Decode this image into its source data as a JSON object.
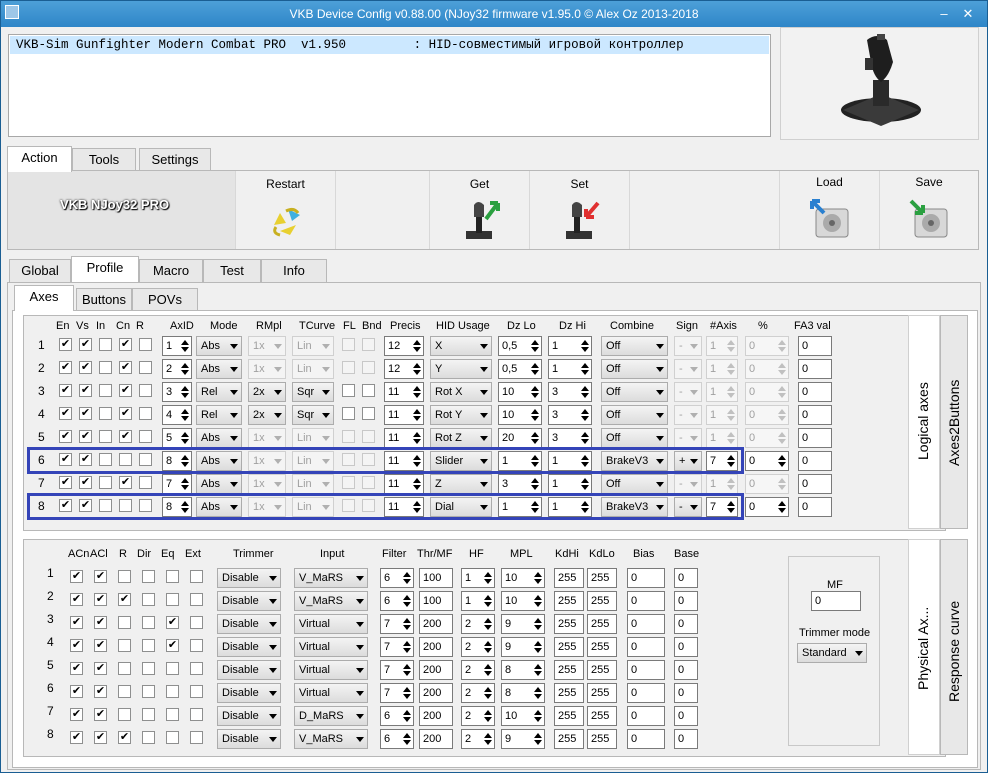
{
  "window": {
    "title": "VKB Device Config v0.88.00 (NJoy32 firmware v1.95.0 © Alex Oz 2013-2018"
  },
  "device_list": {
    "row": "VKB-Sim Gunfighter Modern Combat PRO  v1.950         : HID-совместимый игровой контроллер"
  },
  "main_tabs": [
    "Action",
    "Tools",
    "Settings"
  ],
  "toolbar": {
    "device_name": "VKB NJoy32 PRO",
    "restart": "Restart",
    "get": "Get",
    "set": "Set",
    "load": "Load",
    "save": "Save"
  },
  "section_tabs": [
    "Global",
    "Profile",
    "Macro",
    "Test",
    "Info"
  ],
  "sub_tabs": [
    "Axes",
    "Buttons",
    "POVs"
  ],
  "logical": {
    "headers": {
      "en": "En",
      "vs": "Vs",
      "in": "In",
      "cn": "Cn",
      "r": "R",
      "axid": "AxID",
      "mode": "Mode",
      "rmpl": "RMpl",
      "tcurve": "TCurve",
      "fl": "FL",
      "bnd": "Bnd",
      "precis": "Precis",
      "hid": "HID Usage",
      "dzlo": "Dz Lo",
      "dzhi": "Dz Hi",
      "combine": "Combine",
      "sign": "Sign",
      "naxis": "#Axis",
      "pct": "%",
      "fa3": "FA3 val"
    },
    "rows": [
      {
        "n": "1",
        "en": true,
        "vs": true,
        "in": false,
        "cn": true,
        "r": false,
        "axid": "1",
        "mode": "Abs",
        "rmpl": "1x",
        "rmpl_on": false,
        "tcurve": "Lin",
        "tc_on": false,
        "fl_on": false,
        "precis": "12",
        "hid": "X",
        "dzlo": "0,5",
        "dzhi": "1",
        "combine": "Off",
        "sign": "-",
        "sign_on": false,
        "naxis": "1",
        "naxis_on": false,
        "pct": "0",
        "pct_on": false,
        "fa3": "0"
      },
      {
        "n": "2",
        "en": true,
        "vs": true,
        "in": false,
        "cn": true,
        "r": false,
        "axid": "2",
        "mode": "Abs",
        "rmpl": "1x",
        "rmpl_on": false,
        "tcurve": "Lin",
        "tc_on": false,
        "fl_on": false,
        "precis": "12",
        "hid": "Y",
        "dzlo": "0,5",
        "dzhi": "1",
        "combine": "Off",
        "sign": "-",
        "sign_on": false,
        "naxis": "1",
        "naxis_on": false,
        "pct": "0",
        "pct_on": false,
        "fa3": "0"
      },
      {
        "n": "3",
        "en": true,
        "vs": true,
        "in": false,
        "cn": true,
        "r": false,
        "axid": "3",
        "mode": "Rel",
        "rmpl": "2x",
        "rmpl_on": true,
        "tcurve": "Sqr",
        "tc_on": true,
        "fl_on": true,
        "precis": "11",
        "hid": "Rot X",
        "dzlo": "10",
        "dzhi": "3",
        "combine": "Off",
        "sign": "-",
        "sign_on": false,
        "naxis": "1",
        "naxis_on": false,
        "pct": "0",
        "pct_on": false,
        "fa3": "0"
      },
      {
        "n": "4",
        "en": true,
        "vs": true,
        "in": false,
        "cn": true,
        "r": false,
        "axid": "4",
        "mode": "Rel",
        "rmpl": "2x",
        "rmpl_on": true,
        "tcurve": "Sqr",
        "tc_on": true,
        "fl_on": true,
        "precis": "11",
        "hid": "Rot Y",
        "dzlo": "10",
        "dzhi": "3",
        "combine": "Off",
        "sign": "-",
        "sign_on": false,
        "naxis": "1",
        "naxis_on": false,
        "pct": "0",
        "pct_on": false,
        "fa3": "0"
      },
      {
        "n": "5",
        "en": true,
        "vs": true,
        "in": false,
        "cn": true,
        "r": false,
        "axid": "5",
        "mode": "Abs",
        "rmpl": "1x",
        "rmpl_on": false,
        "tcurve": "Lin",
        "tc_on": false,
        "fl_on": false,
        "precis": "11",
        "hid": "Rot Z",
        "dzlo": "20",
        "dzhi": "3",
        "combine": "Off",
        "sign": "-",
        "sign_on": false,
        "naxis": "1",
        "naxis_on": false,
        "pct": "0",
        "pct_on": false,
        "fa3": "0"
      },
      {
        "n": "6",
        "en": true,
        "vs": true,
        "in": false,
        "cn": false,
        "r": false,
        "axid": "8",
        "mode": "Abs",
        "rmpl": "1x",
        "rmpl_on": false,
        "tcurve": "Lin",
        "tc_on": false,
        "fl_on": false,
        "precis": "11",
        "hid": "Slider",
        "dzlo": "1",
        "dzhi": "1",
        "combine": "BrakeV3",
        "sign": "+",
        "sign_on": true,
        "naxis": "7",
        "naxis_on": true,
        "pct": "0",
        "pct_on": true,
        "fa3": "0"
      },
      {
        "n": "7",
        "en": true,
        "vs": true,
        "in": false,
        "cn": true,
        "r": false,
        "axid": "7",
        "mode": "Abs",
        "rmpl": "1x",
        "rmpl_on": false,
        "tcurve": "Lin",
        "tc_on": false,
        "fl_on": false,
        "precis": "11",
        "hid": "Z",
        "dzlo": "3",
        "dzhi": "1",
        "combine": "Off",
        "sign": "-",
        "sign_on": false,
        "naxis": "1",
        "naxis_on": false,
        "pct": "0",
        "pct_on": false,
        "fa3": "0"
      },
      {
        "n": "8",
        "en": true,
        "vs": true,
        "in": false,
        "cn": false,
        "r": false,
        "axid": "8",
        "mode": "Abs",
        "rmpl": "1x",
        "rmpl_on": false,
        "tcurve": "Lin",
        "tc_on": false,
        "fl_on": false,
        "precis": "11",
        "hid": "Dial",
        "dzlo": "1",
        "dzhi": "1",
        "combine": "BrakeV3",
        "sign": "-",
        "sign_on": true,
        "naxis": "7",
        "naxis_on": true,
        "pct": "0",
        "pct_on": true,
        "fa3": "0"
      }
    ],
    "side_tabs": [
      "Logical axes",
      "Axes2Buttons"
    ]
  },
  "physical": {
    "headers": {
      "acn": "ACn",
      "acl": "ACl",
      "r": "R",
      "dir": "Dir",
      "eq": "Eq",
      "ext": "Ext",
      "trimmer": "Trimmer",
      "input": "Input",
      "filter": "Filter",
      "thrmf": "Thr/MF",
      "hf": "HF",
      "mpl": "MPL",
      "kdhi": "KdHi",
      "kdlo": "KdLo",
      "bias": "Bias",
      "base": "Base"
    },
    "rows": [
      {
        "n": "1",
        "acn": true,
        "acl": true,
        "r": false,
        "dir": false,
        "eq": false,
        "ext": false,
        "trimmer": "Disable",
        "input": "V_MaRS",
        "filter": "6",
        "thr": "100",
        "hf": "1",
        "mpl": "10",
        "kdhi": "255",
        "kdlo": "255",
        "bias": "0",
        "base": "0"
      },
      {
        "n": "2",
        "acn": true,
        "acl": true,
        "r": true,
        "dir": false,
        "eq": false,
        "ext": false,
        "trimmer": "Disable",
        "input": "V_MaRS",
        "filter": "6",
        "thr": "100",
        "hf": "1",
        "mpl": "10",
        "kdhi": "255",
        "kdlo": "255",
        "bias": "0",
        "base": "0"
      },
      {
        "n": "3",
        "acn": true,
        "acl": true,
        "r": false,
        "dir": false,
        "eq": true,
        "ext": false,
        "trimmer": "Disable",
        "input": "Virtual",
        "filter": "7",
        "thr": "200",
        "hf": "2",
        "mpl": "9",
        "kdhi": "255",
        "kdlo": "255",
        "bias": "0",
        "base": "0"
      },
      {
        "n": "4",
        "acn": true,
        "acl": true,
        "r": false,
        "dir": false,
        "eq": true,
        "ext": false,
        "trimmer": "Disable",
        "input": "Virtual",
        "filter": "7",
        "thr": "200",
        "hf": "2",
        "mpl": "9",
        "kdhi": "255",
        "kdlo": "255",
        "bias": "0",
        "base": "0"
      },
      {
        "n": "5",
        "acn": true,
        "acl": true,
        "r": false,
        "dir": false,
        "eq": false,
        "ext": false,
        "trimmer": "Disable",
        "input": "Virtual",
        "filter": "7",
        "thr": "200",
        "hf": "2",
        "mpl": "8",
        "kdhi": "255",
        "kdlo": "255",
        "bias": "0",
        "base": "0"
      },
      {
        "n": "6",
        "acn": true,
        "acl": true,
        "r": false,
        "dir": false,
        "eq": false,
        "ext": false,
        "trimmer": "Disable",
        "input": "Virtual",
        "filter": "7",
        "thr": "200",
        "hf": "2",
        "mpl": "8",
        "kdhi": "255",
        "kdlo": "255",
        "bias": "0",
        "base": "0"
      },
      {
        "n": "7",
        "acn": true,
        "acl": true,
        "r": false,
        "dir": false,
        "eq": false,
        "ext": false,
        "trimmer": "Disable",
        "input": "D_MaRS",
        "filter": "6",
        "thr": "200",
        "hf": "2",
        "mpl": "10",
        "kdhi": "255",
        "kdlo": "255",
        "bias": "0",
        "base": "0"
      },
      {
        "n": "8",
        "acn": true,
        "acl": true,
        "r": true,
        "dir": false,
        "eq": false,
        "ext": false,
        "trimmer": "Disable",
        "input": "V_MaRS",
        "filter": "6",
        "thr": "200",
        "hf": "2",
        "mpl": "9",
        "kdhi": "255",
        "kdlo": "255",
        "bias": "0",
        "base": "0"
      }
    ],
    "mf_label": "MF",
    "mf_value": "0",
    "trimmer_mode_label": "Trimmer mode",
    "trimmer_mode": "Standard",
    "side_tabs": [
      "Physical Ax...",
      "Response curve"
    ]
  }
}
